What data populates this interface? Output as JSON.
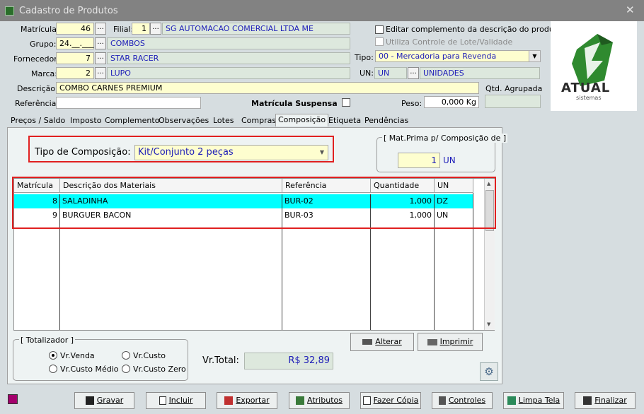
{
  "window": {
    "title": "Cadastro de Produtos"
  },
  "header": {
    "matricula_label": "Matrícula:",
    "matricula": "46",
    "filial_label": "Filial:",
    "filial_code": "1",
    "filial_name": "SG AUTOMACAO COMERCIAL LTDA ME",
    "grupo_label": "Grupo:",
    "grupo_code": "24.__.___",
    "grupo_name": "COMBOS",
    "fornecedor_label": "Fornecedor:",
    "fornecedor_code": "7",
    "fornecedor_name": "STAR RACER",
    "marca_label": "Marca:",
    "marca_code": "2",
    "marca_name": "LUPO",
    "descricao_label": "Descrição:",
    "descricao": "COMBO CARNES PREMIUM",
    "referencia_label": "Referência:",
    "referencia": "",
    "suspensa_label": "Matrícula Suspensa",
    "editar_label": "Editar complemento da descrição do produto",
    "lote_label": "Utiliza Controle de Lote/Validade",
    "tipo_label": "Tipo:",
    "tipo_value": "00 - Mercadoria para Revenda",
    "un_label": "UN:",
    "un_code": "UN",
    "un_name": "UNIDADES",
    "qtd_label": "Qtd. Agrupada",
    "peso_label": "Peso:",
    "peso": "0,000 Kg",
    "logo_text": "ATUAL",
    "logo_sub": "sistemas"
  },
  "tabs": [
    "Preços / Saldo",
    "Imposto",
    "Complemento",
    "Observações",
    "Lotes",
    "Compras",
    "Composição",
    "Etiqueta",
    "Pendências"
  ],
  "composicao": {
    "tipo_label": "Tipo de Composição:",
    "tipo_value": "Kit/Conjunto 2 peças",
    "matprima_label": "[ Mat.Prima p/ Composição de ]",
    "matprima_value": "1",
    "matprima_un": "UN",
    "columns": [
      "Matrícula",
      "Descrição dos Materiais",
      "Referência",
      "Quantidade",
      "UN"
    ],
    "rows": [
      {
        "matricula": "8",
        "descricao": "SALADINHA",
        "referencia": "BUR-02",
        "quantidade": "1,000",
        "un": "DZ"
      },
      {
        "matricula": "9",
        "descricao": "BURGUER BACON",
        "referencia": "BUR-03",
        "quantidade": "1,000",
        "un": "UN"
      }
    ],
    "alterar": "Alterar",
    "imprimir": "Imprimir",
    "totalizador_label": "[ Totalizador ]",
    "opt_venda": "Vr.Venda",
    "opt_custo": "Vr.Custo",
    "opt_custo_medio": "Vr.Custo Médio",
    "opt_custo_zero": "Vr.Custo Zero",
    "vrtotal_label": "Vr.Total:",
    "vrtotal_value": "R$ 32,89"
  },
  "toolbar": {
    "gravar": "Gravar",
    "incluir": "Incluir",
    "exportar": "Exportar",
    "atributos": "Atributos",
    "fazer_copia": "Fazer Cópia",
    "controles": "Controles",
    "limpa_tela": "Limpa Tela",
    "finalizar": "Finalizar"
  },
  "colors": {
    "selected_row": "#00ffff",
    "highlight_border": "#e02020",
    "field_value": "#1d1db8"
  }
}
